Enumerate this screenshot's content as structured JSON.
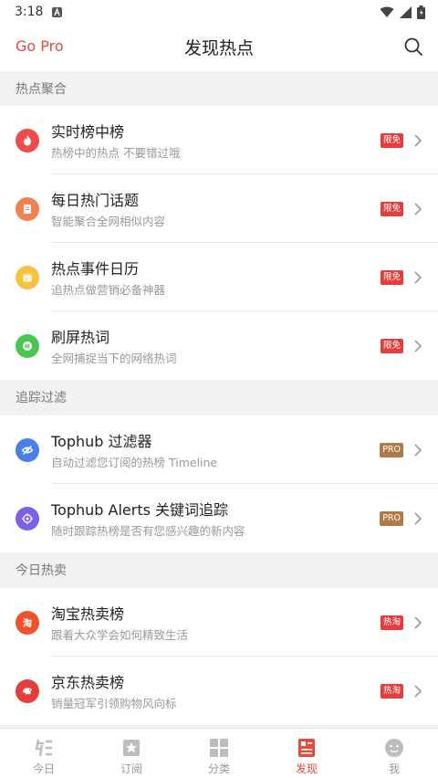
{
  "status_bar": {
    "time": "3:18"
  },
  "header": {
    "left_link": "Go Pro",
    "title": "发现热点"
  },
  "sections": [
    {
      "label": "热点聚合",
      "items": [
        {
          "title": "实时榜中榜",
          "subtitle": "热榜中的热点 不要错过哦",
          "badge": "限免",
          "icon": "fire-icon",
          "color": "#ef4b4b"
        },
        {
          "title": "每日热门话题",
          "subtitle": "智能聚合全网相似内容",
          "badge": "限免",
          "icon": "document-icon",
          "color": "#f47f4f"
        },
        {
          "title": "热点事件日历",
          "subtitle": "追热点做营销必备神器",
          "badge": "限免",
          "icon": "calendar-icon",
          "color": "#f7c240"
        },
        {
          "title": "刷屏热词",
          "subtitle": "全网捕捉当下的网络热词",
          "badge": "限免",
          "icon": "hashtag-icon",
          "color": "#4cc653"
        }
      ]
    },
    {
      "label": "追踪过滤",
      "items": [
        {
          "title": "Tophub 过滤器",
          "subtitle": "自动过滤您订阅的热榜 Timeline",
          "badge": "PRO",
          "icon": "eye-off-icon",
          "color": "#4a7fe8"
        },
        {
          "title": "Tophub Alerts 关键词追踪",
          "subtitle": "随时跟踪热榜是否有您感兴趣的新内容",
          "badge": "PRO",
          "icon": "target-icon",
          "color": "#7e5fe6"
        }
      ]
    },
    {
      "label": "今日热卖",
      "items": [
        {
          "title": "淘宝热卖榜",
          "subtitle": "跟着大众学会如何精致生活",
          "badge": "热淘",
          "icon": "taobao-icon",
          "color": "#f0522b"
        },
        {
          "title": "京东热卖榜",
          "subtitle": "销量冠军引领购物风向标",
          "badge": "热淘",
          "icon": "jd-icon",
          "color": "#e53c3c"
        }
      ]
    }
  ],
  "bottom_nav": [
    {
      "label": "今日",
      "icon": "today-icon",
      "active": false
    },
    {
      "label": "订阅",
      "icon": "subscribe-icon",
      "active": false
    },
    {
      "label": "分类",
      "icon": "category-icon",
      "active": false
    },
    {
      "label": "发现",
      "icon": "discover-icon",
      "active": true
    },
    {
      "label": "我",
      "icon": "profile-icon",
      "active": false
    }
  ],
  "colors": {
    "accent": "#e64a3c",
    "badge_free": "#e83b3b",
    "badge_pro": "#b07a4a",
    "badge_hot": "#e83b3b"
  }
}
